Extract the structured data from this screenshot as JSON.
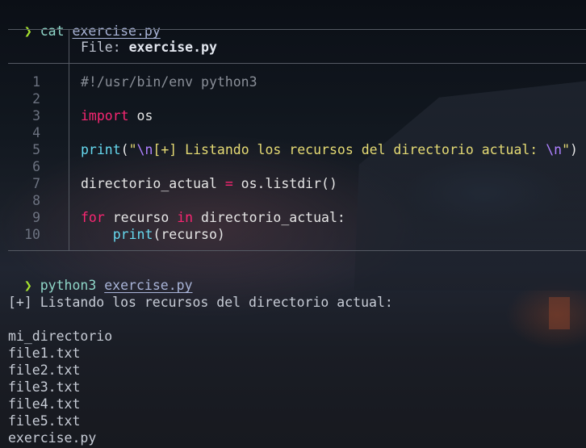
{
  "terminal": {
    "prompt_symbol": "❯",
    "commands": [
      {
        "cmd": "cat",
        "arg": "exercise.py"
      },
      {
        "cmd": "python3",
        "arg": "exercise.py"
      }
    ],
    "file_header_label": "File: ",
    "file_header_name": "exercise.py",
    "line_numbers": [
      "1",
      "2",
      "3",
      "4",
      "5",
      "6",
      "7",
      "8",
      "9",
      "10"
    ],
    "code": {
      "l1": "#!/usr/bin/env python3",
      "l3_kw": "import",
      "l3_rest": " os",
      "l5_fn": "print",
      "l5_open": "(",
      "l5_q1": "\"",
      "l5_esc1": "\\n",
      "l5_text": "[+] Listando los recursos del directorio actual: ",
      "l5_esc2": "\\n",
      "l5_q2": "\"",
      "l5_close": ")",
      "l7_var": "directorio_actual ",
      "l7_op": "=",
      "l7_rest": " os.listdir()",
      "l9_kw1": "for",
      "l9_mid": " recurso ",
      "l9_kw2": "in",
      "l9_rest": " directorio_actual:",
      "l10_indent": "    ",
      "l10_fn": "print",
      "l10_rest": "(recurso)"
    },
    "output": {
      "header": "[+] Listando los recursos del directorio actual:",
      "files": [
        "mi_directorio",
        "file1.txt",
        "file2.txt",
        "file3.txt",
        "file4.txt",
        "file5.txt",
        "exercise.py"
      ]
    }
  }
}
